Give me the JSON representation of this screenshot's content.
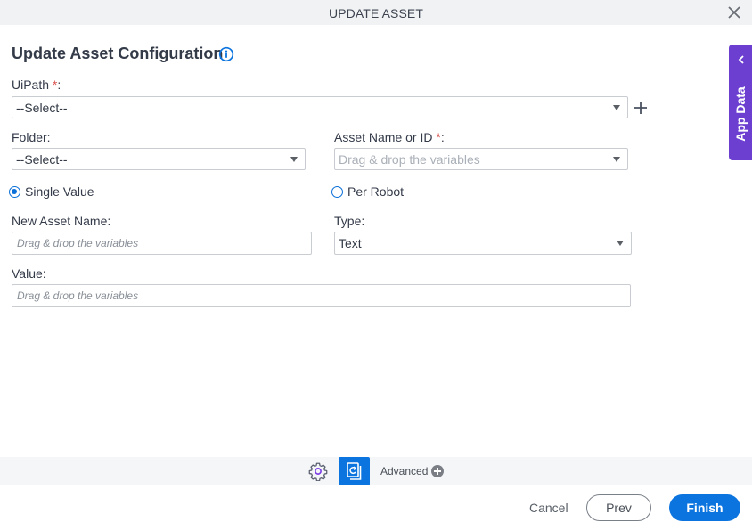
{
  "window": {
    "title": "UPDATE ASSET",
    "close_icon": "close-icon"
  },
  "heading": {
    "title": "Update Asset Configuration",
    "info_icon": "info-icon"
  },
  "fields": {
    "uipath": {
      "label": "UiPath",
      "required_mark": "*",
      "suffix": ":",
      "value": "--Select--"
    },
    "folder": {
      "label": "Folder:",
      "value": "--Select--"
    },
    "asset_name": {
      "label": "Asset Name or ID",
      "required_mark": "*",
      "suffix": ":",
      "placeholder": "Drag & drop the variables"
    },
    "new_asset_name": {
      "label": "New Asset Name:",
      "placeholder": "Drag & drop the variables"
    },
    "type": {
      "label": "Type:",
      "value": "Text"
    },
    "value": {
      "label": "Value:",
      "placeholder": "Drag & drop the variables"
    }
  },
  "radios": [
    {
      "label": "Single Value",
      "checked": true
    },
    {
      "label": "Per Robot",
      "checked": false
    }
  ],
  "side_panel": {
    "label": "App Data",
    "icon": "chevron-left-icon"
  },
  "toolbar": {
    "settings_icon": "gear-icon",
    "copy_icon": "copy-refresh-icon",
    "advanced_label": "Advanced"
  },
  "footer": {
    "cancel_label": "Cancel",
    "prev_label": "Prev",
    "finish_label": "Finish"
  },
  "colors": {
    "accent": "#0b74de",
    "side_panel": "#6c3fd1",
    "required": "#d9534f"
  }
}
